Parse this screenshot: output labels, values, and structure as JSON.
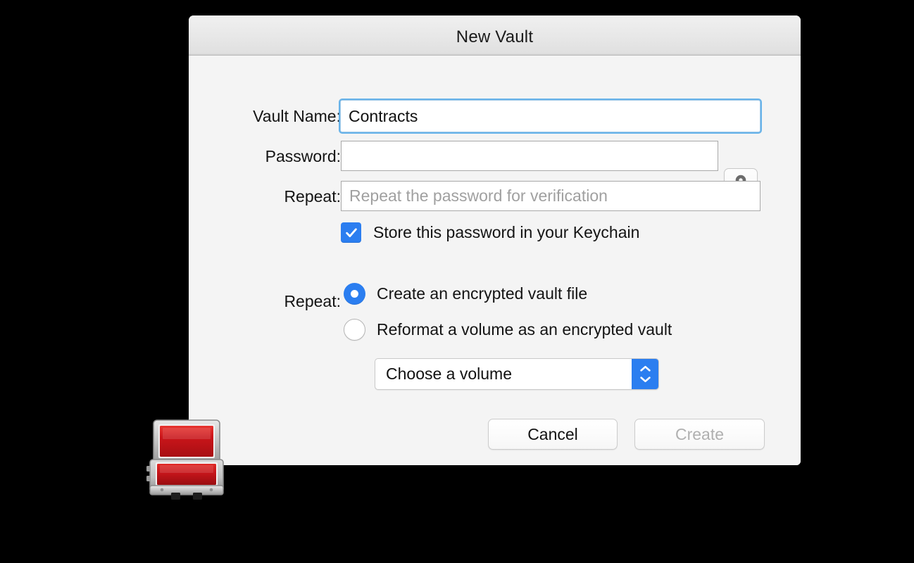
{
  "window": {
    "title": "New Vault"
  },
  "form": {
    "vault_name": {
      "label": "Vault Name:",
      "value": "Contracts",
      "placeholder": ""
    },
    "password": {
      "label": "Password:",
      "value": "",
      "placeholder": ""
    },
    "repeat": {
      "label": "Repeat:",
      "value": "",
      "placeholder": "Repeat the password for verification"
    },
    "password_button_icon": "key-icon",
    "keychain_checkbox": {
      "label": "Store this password in your Keychain",
      "checked": true
    },
    "mode": {
      "label": "Repeat:",
      "options": [
        {
          "label": "Create an encrypted vault file",
          "selected": true
        },
        {
          "label": "Reformat a volume as an encrypted vault",
          "selected": false
        }
      ]
    },
    "volume_select": {
      "value": "Choose a volume",
      "stepper_icons": [
        "chevron-up-icon",
        "chevron-down-icon"
      ]
    }
  },
  "footer": {
    "cancel_label": "Cancel",
    "create_label": "Create",
    "create_enabled": false
  },
  "desktop_icon": {
    "name": "vault-briefcase-icon"
  },
  "colors": {
    "accent_blue": "#2b7ef0",
    "focus_ring": "#4fa7e6",
    "window_body": "#f4f4f4",
    "titlebar_top": "#f0f0f0",
    "titlebar_bottom": "#d4d4d4",
    "disabled_text": "#b0b0b0",
    "placeholder_text": "#a0a0a0",
    "background": "#000000",
    "icon_red": "#c4151a",
    "icon_gray": "#b6b6b6"
  }
}
